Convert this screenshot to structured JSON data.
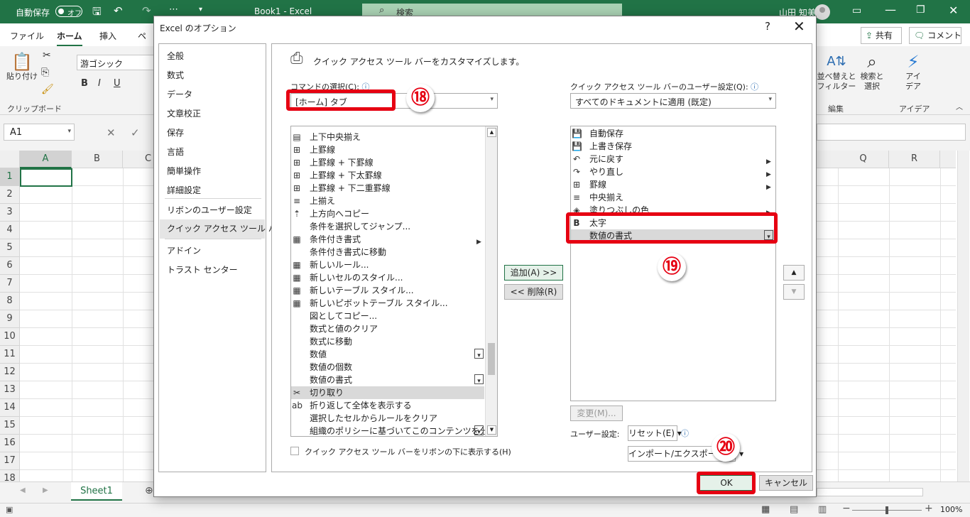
{
  "titlebar": {
    "autosave_label": "自動保存",
    "autosave_state": "オフ",
    "doc_title": "Book1  -  Excel",
    "search_placeholder": "検索",
    "user_name": "山田 知美"
  },
  "ribbon": {
    "tabs": [
      "ファイル",
      "ホーム",
      "挿入",
      "ペ"
    ],
    "active_tab": "ホーム",
    "share_label": "共有",
    "comment_label": "コメント",
    "paste_label": "貼り付け",
    "clipboard_group": "クリップボード",
    "font_name": "游ゴシック",
    "bold": "B",
    "italic": "I",
    "underline": "U",
    "sort_filter_label_1": "並べ替えと",
    "sort_filter_label_2": "フィルター",
    "find_select_label_1": "検索と",
    "find_select_label_2": "選択",
    "edit_group": "編集",
    "ideas_label_1": "アイ",
    "ideas_label_2": "デア",
    "ideas_group": "アイデア"
  },
  "formula_bar": {
    "name_box": "A1"
  },
  "grid": {
    "columns_left": [
      "A",
      "B",
      "C"
    ],
    "columns_right": [
      "Q",
      "R"
    ],
    "rows": [
      "1",
      "2",
      "3",
      "4",
      "5",
      "6",
      "7",
      "8",
      "9",
      "10",
      "11",
      "12",
      "13",
      "14",
      "15",
      "16",
      "17",
      "18"
    ],
    "sheet_tab": "Sheet1",
    "zoom": "100%"
  },
  "dialog": {
    "title": "Excel のオプション",
    "help": "?",
    "close": "✕",
    "nav": [
      "全般",
      "数式",
      "データ",
      "文章校正",
      "保存",
      "言語",
      "簡単操作",
      "詳細設定",
      "リボンのユーザー設定",
      "クイック アクセス ツール バー",
      "アドイン",
      "トラスト センター"
    ],
    "nav_selected": "クイック アクセス ツール バー",
    "heading": "クイック アクセス ツール バーをカスタマイズします。",
    "choose_label": "コマンドの選択(C):",
    "choose_value": "[ホーム] タブ",
    "customize_label": "クイック アクセス ツール バーのユーザー設定(Q):",
    "customize_value": "すべてのドキュメントに適用 (既定)",
    "commands": [
      {
        "icon": "▤",
        "label": "上下中央揃え"
      },
      {
        "icon": "⊞",
        "label": "上罫線"
      },
      {
        "icon": "⊞",
        "label": "上罫線 + 下罫線"
      },
      {
        "icon": "⊞",
        "label": "上罫線 + 下太罫線"
      },
      {
        "icon": "⊞",
        "label": "上罫線 + 下二重罫線"
      },
      {
        "icon": "≡",
        "label": "上揃え"
      },
      {
        "icon": "⇡",
        "label": "上方向へコピー"
      },
      {
        "icon": "",
        "label": "条件を選択してジャンプ..."
      },
      {
        "icon": "▦",
        "label": "条件付き書式"
      },
      {
        "icon": "",
        "label": "条件付き書式に移動"
      },
      {
        "icon": "▦",
        "label": "新しいルール..."
      },
      {
        "icon": "▦",
        "label": "新しいセルのスタイル..."
      },
      {
        "icon": "▦",
        "label": "新しいテーブル スタイル..."
      },
      {
        "icon": "▦",
        "label": "新しいピボットテーブル スタイル..."
      },
      {
        "icon": "",
        "label": "図としてコピー..."
      },
      {
        "icon": "",
        "label": "数式と値のクリア"
      },
      {
        "icon": "",
        "label": "数式に移動"
      },
      {
        "icon": "",
        "label": "数値"
      },
      {
        "icon": "",
        "label": "数値の個数"
      },
      {
        "icon": "",
        "label": "数値の書式"
      },
      {
        "icon": "✂",
        "label": "切り取り"
      },
      {
        "icon": "ab",
        "label": "折り返して全体を表示する"
      },
      {
        "icon": "",
        "label": "選択したセルからルールをクリア"
      },
      {
        "icon": "",
        "label": "組織のポリシーに基づいてこのコンテンツを分..."
      }
    ],
    "qat_items": [
      {
        "icon": "💾",
        "label": "自動保存"
      },
      {
        "icon": "💾",
        "label": "上書き保存"
      },
      {
        "icon": "↶",
        "label": "元に戻す"
      },
      {
        "icon": "↷",
        "label": "やり直し"
      },
      {
        "icon": "⊞",
        "label": "罫線"
      },
      {
        "icon": "≡",
        "label": "中央揃え"
      },
      {
        "icon": "◈",
        "label": "塗りつぶしの色"
      },
      {
        "icon": "B",
        "label": "太字"
      },
      {
        "icon": "",
        "label": "数値の書式"
      }
    ],
    "add_button": "追加(A) >>",
    "remove_button": "<< 削除(R)",
    "modify_button": "変更(M)...",
    "show_below_label": "クイック アクセス ツール バーをリボンの下に表示する(H)",
    "user_settings_label": "ユーザー設定:",
    "reset_button": "リセット(E) ▾",
    "import_export_button": "インポート/エクスポート(P) ▾",
    "ok_button": "OK",
    "cancel_button": "キャンセル"
  },
  "annotations": {
    "badge_18": "⑱",
    "badge_19": "⑲",
    "badge_20": "⑳"
  },
  "colors": {
    "excel_green": "#217346",
    "annotation_red": "#e60012"
  }
}
